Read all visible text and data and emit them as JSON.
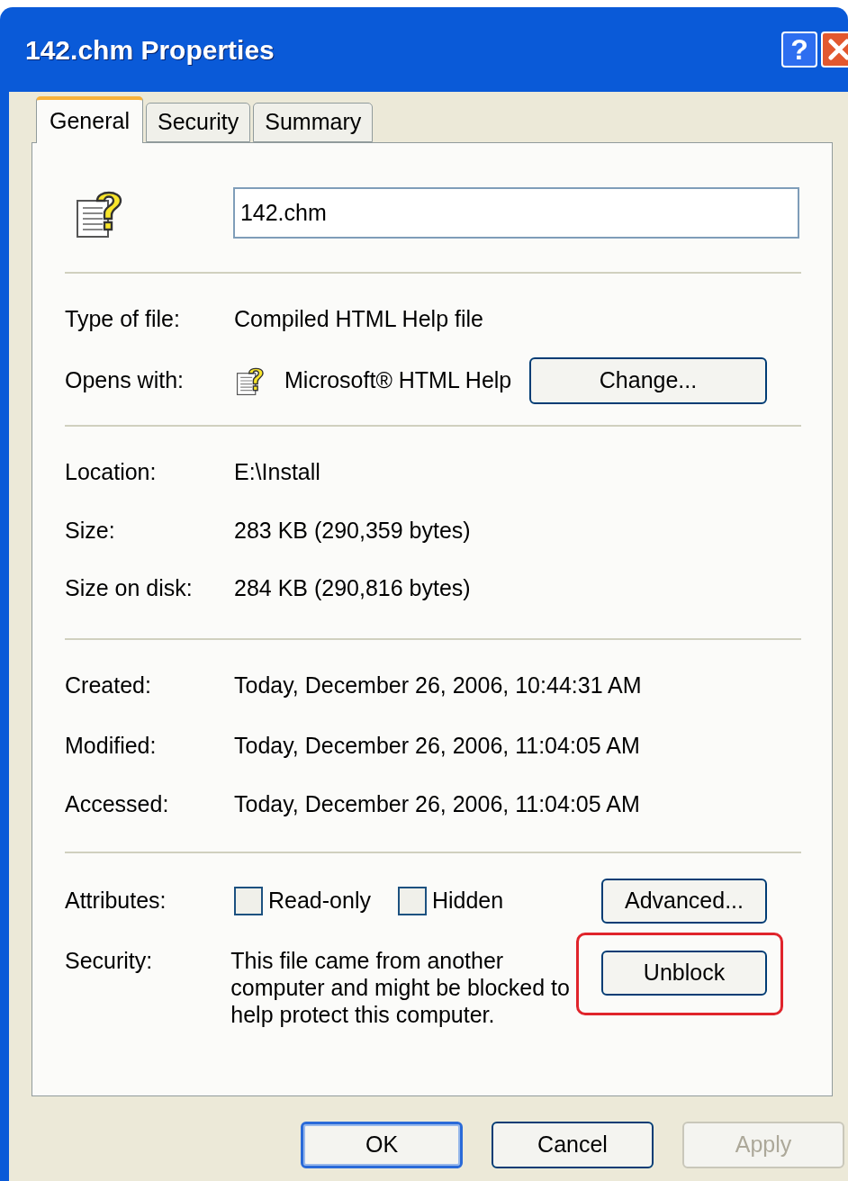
{
  "window": {
    "title": "142.chm Properties",
    "help_button": "?"
  },
  "tabs": [
    {
      "label": "General",
      "selected": true
    },
    {
      "label": "Security",
      "selected": false
    },
    {
      "label": "Summary",
      "selected": false
    }
  ],
  "general": {
    "file_name": "142.chm",
    "groups": [
      [
        {
          "label": "Type of file:",
          "value": "Compiled HTML Help file"
        },
        {
          "label": "Opens with:",
          "value": "Microsoft® HTML Help",
          "button": "Change..."
        }
      ],
      [
        {
          "label": "Location:",
          "value": "E:\\Install"
        },
        {
          "label": "Size:",
          "value": "283 KB (290,359 bytes)"
        },
        {
          "label": "Size on disk:",
          "value": "284 KB (290,816 bytes)"
        }
      ],
      [
        {
          "label": "Created:",
          "value": "Today, December 26, 2006, 10:44:31 AM"
        },
        {
          "label": "Modified:",
          "value": "Today, December 26, 2006, 11:04:05 AM"
        },
        {
          "label": "Accessed:",
          "value": "Today, December 26, 2006, 11:04:05 AM"
        }
      ]
    ],
    "attributes": {
      "label": "Attributes:",
      "button": "Advanced...",
      "checkboxes": [
        {
          "label": "Read-only",
          "checked": false
        },
        {
          "label": "Hidden",
          "checked": false
        }
      ]
    },
    "security": {
      "label": "Security:",
      "text": "This file came from another computer and might be blocked to help protect this computer.",
      "button": "Unblock",
      "highlighted": true
    }
  },
  "buttons": [
    {
      "label": "OK",
      "default": true,
      "disabled": false
    },
    {
      "label": "Cancel",
      "default": false,
      "disabled": false
    },
    {
      "label": "Apply",
      "default": false,
      "disabled": true
    }
  ]
}
